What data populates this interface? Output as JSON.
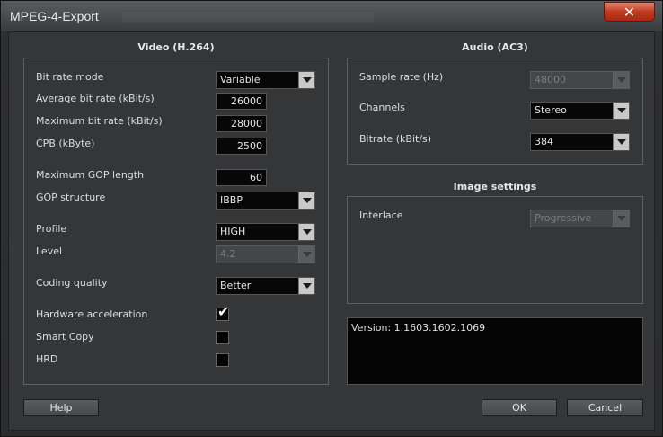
{
  "window": {
    "title": "MPEG-4-Export",
    "close_label": "✕"
  },
  "video": {
    "title": "Video (H.264)",
    "bit_rate_mode": {
      "label": "Bit rate mode",
      "value": "Variable"
    },
    "average_bit_rate": {
      "label": "Average bit rate (kBit/s)",
      "value": "26000"
    },
    "maximum_bit_rate": {
      "label": "Maximum bit rate (kBit/s)",
      "value": "28000"
    },
    "cpb": {
      "label": "CPB (kByte)",
      "value": "2500"
    },
    "max_gop": {
      "label": "Maximum GOP length",
      "value": "60"
    },
    "gop_structure": {
      "label": "GOP structure",
      "value": "IBBP"
    },
    "profile": {
      "label": "Profile",
      "value": "HIGH"
    },
    "level": {
      "label": "Level",
      "value": "4.2"
    },
    "coding_quality": {
      "label": "Coding quality",
      "value": "Better"
    },
    "hardware_acceleration": {
      "label": "Hardware acceleration",
      "checked": true
    },
    "smart_copy": {
      "label": "Smart Copy",
      "checked": false
    },
    "hrd": {
      "label": "HRD",
      "checked": false
    }
  },
  "audio": {
    "title": "Audio (AC3)",
    "sample_rate": {
      "label": "Sample rate (Hz)",
      "value": "48000"
    },
    "channels": {
      "label": "Channels",
      "value": "Stereo"
    },
    "bitrate": {
      "label": "Bitrate (kBit/s)",
      "value": "384"
    }
  },
  "image": {
    "title": "Image settings",
    "interlace": {
      "label": "Interlace",
      "value": "Progressive"
    }
  },
  "version_text": "Version: 1.1603.1602.1069",
  "buttons": {
    "help": "Help",
    "ok": "OK",
    "cancel": "Cancel"
  },
  "icons": {
    "check": "checkmark-icon",
    "close": "close-icon",
    "dropdown": "chevron-down-icon"
  },
  "colors": {
    "close_button": "#c13a1f",
    "field_background": "#070707",
    "panel_background": "#353638"
  }
}
